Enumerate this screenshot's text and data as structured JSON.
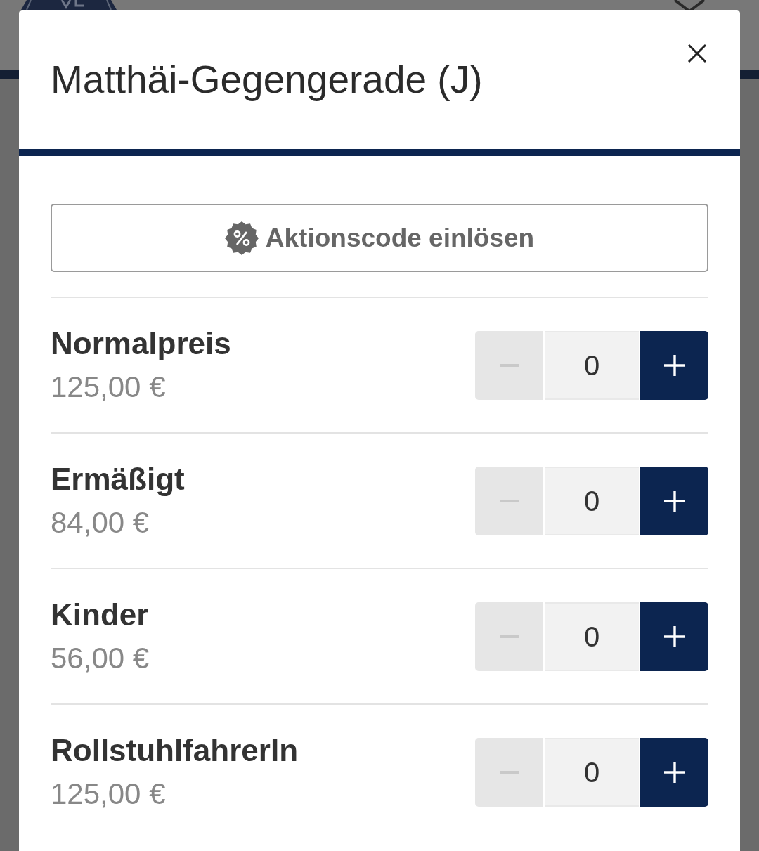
{
  "dialog": {
    "title": "Matthäi-Gegengerade (J)"
  },
  "promo_button": {
    "label": "Aktionscode einlösen"
  },
  "ticket_types": [
    {
      "name": "Normalpreis",
      "price": "125,00 €",
      "quantity": "0",
      "decrement_disabled": true
    },
    {
      "name": "Ermäßigt",
      "price": "84,00 €",
      "quantity": "0",
      "decrement_disabled": true
    },
    {
      "name": "Kinder",
      "price": "56,00 €",
      "quantity": "0",
      "decrement_disabled": true
    },
    {
      "name": "RollstuhlfahrerIn",
      "price": "125,00 €",
      "quantity": "0",
      "decrement_disabled": true
    }
  ]
}
